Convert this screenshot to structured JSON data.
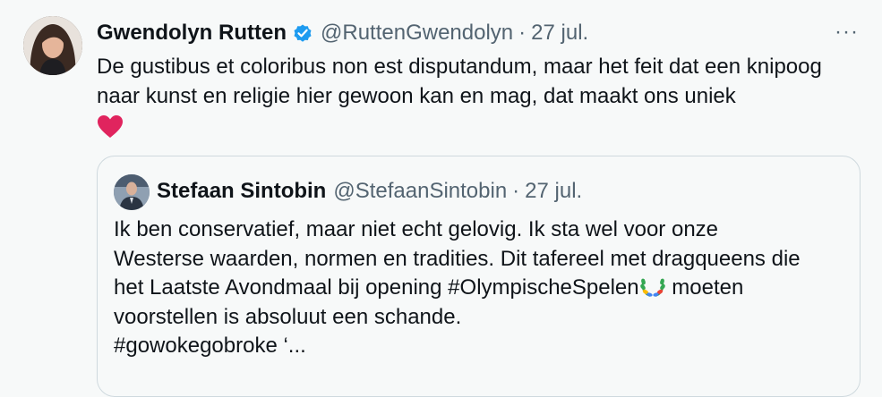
{
  "tweet": {
    "author_name": "Gwendolyn Rutten",
    "handle": "@RuttenGwendolyn",
    "separator": "·",
    "date": "27 jul.",
    "more_label": "···",
    "text": "De gustibus et coloribus non est disputandum, maar het feit dat een knipoog naar kunst en religie hier gewoon kan en mag, dat maakt ons uniek",
    "emoji": "heart-emoji",
    "verified_color": "#1d9bf0"
  },
  "quote": {
    "author_name": "Stefaan Sintobin",
    "handle": "@StefaanSintobin",
    "separator": "·",
    "date": "27 jul.",
    "text_line1": "Ik ben conservatief, maar niet echt gelovig. Ik sta wel voor onze",
    "text_line2": "Westerse waarden, normen en tradities. Dit tafereel met dragqueens die",
    "text_line3a": "het Laatste Avondmaal bij opening #OlympischeSpelen",
    "text_line3b": " moeten",
    "text_line4": "voorstellen is absoluut een schande.",
    "text_line5": "#gowokegobroke ‘...",
    "emoji": "olympic-wreath-emoji"
  }
}
